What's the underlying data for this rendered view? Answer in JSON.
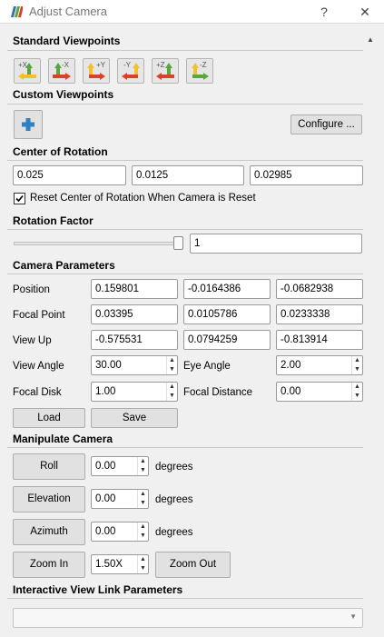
{
  "window": {
    "title": "Adjust Camera",
    "help_label": "?",
    "close_label": "✕"
  },
  "standard_viewpoints": {
    "heading": "Standard Viewpoints",
    "buttons": [
      {
        "label": "+X",
        "icon": "set-view-positive-x-icon"
      },
      {
        "label": "-X",
        "icon": "set-view-negative-x-icon"
      },
      {
        "label": "+Y",
        "icon": "set-view-positive-y-icon"
      },
      {
        "label": "-Y",
        "icon": "set-view-negative-y-icon"
      },
      {
        "label": "+Z",
        "icon": "set-view-positive-z-icon"
      },
      {
        "label": "-Z",
        "icon": "set-view-negative-z-icon"
      }
    ]
  },
  "custom_viewpoints": {
    "heading": "Custom Viewpoints",
    "add_icon": "plus-icon",
    "configure_label": "Configure ..."
  },
  "center_of_rotation": {
    "heading": "Center of Rotation",
    "x": "0.025",
    "y": "0.0125",
    "z": "0.02985",
    "reset_label": "Reset Center of Rotation When Camera is Reset",
    "reset_checked": true
  },
  "rotation_factor": {
    "heading": "Rotation Factor",
    "value": "1",
    "slider_fraction": 1.0
  },
  "camera_parameters": {
    "heading": "Camera Parameters",
    "position_label": "Position",
    "position": [
      "0.159801",
      "-0.0164386",
      "-0.0682938"
    ],
    "focal_point_label": "Focal Point",
    "focal_point": [
      "0.03395",
      "0.0105786",
      "0.0233338"
    ],
    "view_up_label": "View Up",
    "view_up": [
      "-0.575531",
      "0.0794259",
      "-0.813914"
    ],
    "view_angle_label": "View Angle",
    "view_angle": "30.00",
    "eye_angle_label": "Eye Angle",
    "eye_angle": "2.00",
    "focal_disk_label": "Focal Disk",
    "focal_disk": "1.00",
    "focal_distance_label": "Focal Distance",
    "focal_distance": "0.00",
    "load_label": "Load",
    "save_label": "Save"
  },
  "manipulate_camera": {
    "heading": "Manipulate Camera",
    "roll_label": "Roll",
    "roll_value": "0.00",
    "elevation_label": "Elevation",
    "elevation_value": "0.00",
    "azimuth_label": "Azimuth",
    "azimuth_value": "0.00",
    "degrees_label": "degrees",
    "zoom_in_label": "Zoom In",
    "zoom_value": "1.50X",
    "zoom_out_label": "Zoom Out"
  },
  "interactive_view_link": {
    "heading": "Interactive View Link Parameters",
    "selected": ""
  },
  "colors": {
    "arrow_yellow": "#f2c12e",
    "arrow_red": "#d9412b",
    "arrow_green": "#5aa540",
    "plus_blue": "#2f7fc1"
  }
}
